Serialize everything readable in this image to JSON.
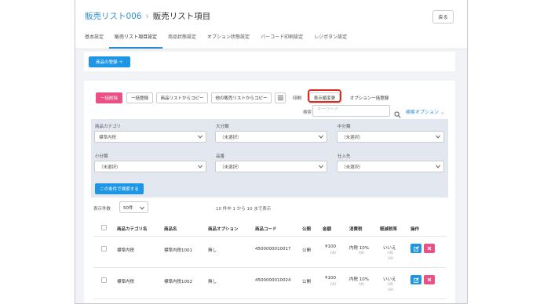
{
  "breadcrumb": {
    "list": "販売リスト006",
    "current": "販売リスト項目"
  },
  "back_label": "戻る",
  "tabs": [
    "基本設定",
    "販売リスト項目設定",
    "商品状態設定",
    "オプション状態設定",
    "バーコード印刷設定",
    "レジボタン設定"
  ],
  "active_tab": 1,
  "add_button": "商品の登録 ＋",
  "toolbar": {
    "bulk_delete": "一括削除",
    "bulk_register": "一括登録",
    "copy_from_list": "商品リストからコピー",
    "copy_from_other": "他の販売リストからコピー",
    "print": "印刷",
    "display_order": "表示順変更",
    "option_bulk": "オプション一括登録"
  },
  "search": {
    "label": "検索：",
    "placeholder": "キーワード",
    "advanced": "検索オプション"
  },
  "filters": {
    "category_label": "商品カテゴリ",
    "category_value": "標準内税",
    "major_label": "大分類",
    "major_value": "（未選択）",
    "middle_label": "中分類",
    "middle_value": "（未選択）",
    "minor_label": "小分類",
    "minor_value": "（未選択）",
    "product_label": "品番",
    "product_value": "（未選択）",
    "supplier_label": "仕入先",
    "supplier_value": "（未選択）",
    "search_button": "この条件で検索する"
  },
  "page_size": {
    "label": "表示件数",
    "value": "50件"
  },
  "range_text": "10 件中 1 から 10 まで表示",
  "table": {
    "headers": [
      "商品カテゴリ名",
      "商品名",
      "商品オプション",
      "商品コード",
      "公開",
      "金額",
      "消費税",
      "軽減税率",
      "操作"
    ],
    "rows": [
      {
        "category": "標準内税",
        "name": "標準内税1001",
        "option": "無し",
        "code": "4500000010017",
        "public": "公開",
        "price": "¥100",
        "price_sub": "(\\0)",
        "tax": "内税 10%",
        "tax_sub": "(\\9)",
        "reduced": "いいえ",
        "reduced_sub1": "(\\9)",
        "reduced_sub2": "(\\0)"
      },
      {
        "category": "標準内税",
        "name": "標準内税1002",
        "option": "無し",
        "code": "4500000010024",
        "public": "公開",
        "price": "¥100",
        "price_sub": "(\\0)",
        "tax": "内税 10%",
        "tax_sub": "(\\9)",
        "reduced": "いいえ",
        "reduced_sub1": "(\\9)",
        "reduced_sub2": "(\\0)"
      }
    ]
  },
  "colors": {
    "accent": "#1e96e6",
    "danger": "#ea4f86",
    "highlight": "#e0281e"
  }
}
